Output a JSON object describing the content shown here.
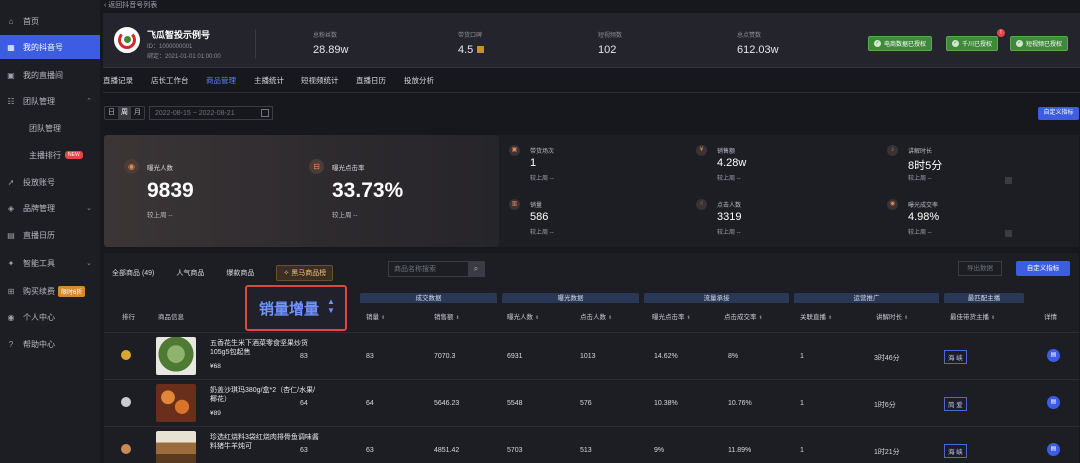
{
  "sidebar": {
    "items": [
      {
        "label": "首页",
        "icon": "home-icon"
      },
      {
        "label": "我的抖音号",
        "icon": "grid-icon",
        "active": true
      },
      {
        "label": "我的直播间",
        "icon": "live-icon"
      },
      {
        "label": "团队管理",
        "icon": "team-icon"
      },
      {
        "label": "团队管理"
      },
      {
        "label": "主播排行",
        "badge": "NEW"
      },
      {
        "label": "投放账号",
        "icon": "rocket-icon"
      },
      {
        "label": "品牌管理",
        "icon": "brand-icon"
      },
      {
        "label": "直播日历",
        "icon": "calendar-icon"
      },
      {
        "label": "智能工具",
        "icon": "tool-icon"
      },
      {
        "label": "购买续费",
        "icon": "cart-icon",
        "tag": "限时6折"
      },
      {
        "label": "个人中心",
        "icon": "user-icon"
      },
      {
        "label": "帮助中心",
        "icon": "help-icon"
      }
    ]
  },
  "header": {
    "back": "返回抖音号列表",
    "name": "飞瓜智投示例号",
    "id": "ID：1000000001",
    "bind": "绑定：2021-01-01 01:00:00",
    "stats": [
      {
        "label": "总粉丝数",
        "value": "28.89w"
      },
      {
        "label": "带货口碑",
        "value": "4.5"
      },
      {
        "label": "短视频数",
        "value": "102"
      },
      {
        "label": "总点赞数",
        "value": "612.03w"
      }
    ],
    "auth_buttons": [
      "电商数据已授权",
      "千川已授权",
      "短视频已授权"
    ]
  },
  "tabs": [
    "直播记录",
    "店长工作台",
    "商品管理",
    "主播统计",
    "短视频统计",
    "直播日历",
    "投放分析"
  ],
  "active_tab": "商品管理",
  "date": {
    "seg": [
      "日",
      "周",
      "月"
    ],
    "range": "2022-08-15 ~ 2022-08-21",
    "custom_btn": "自定义指标"
  },
  "overview": {
    "big": [
      {
        "label": "曝光人数",
        "value": "9839",
        "sub": "较上周 --"
      },
      {
        "label": "曝光点击率",
        "value": "33.73%",
        "sub": "较上周 --"
      }
    ],
    "mini": [
      {
        "label": "带货场次",
        "value": "1",
        "sub": "较上周 --"
      },
      {
        "label": "销售额",
        "value": "4.28w",
        "sub": "较上周 --"
      },
      {
        "label": "讲解时长",
        "value": "8时5分",
        "sub": "较上周 --"
      },
      {
        "label": "销量",
        "value": "586",
        "sub": "较上周 --"
      },
      {
        "label": "点击人数",
        "value": "3319",
        "sub": "较上周 --"
      },
      {
        "label": "曝光成交率",
        "value": "4.98%",
        "sub": "较上周 --"
      }
    ]
  },
  "products": {
    "filter_tabs": [
      "全部商品 (49)",
      "人气商品",
      "爆款商品",
      "黑马商品榜"
    ],
    "search_placeholder": "商品名称搜索",
    "export_btn": "导出数据",
    "custom_btn": "自定义指标",
    "group_headers": [
      "成交数据",
      "曝光数据",
      "流量承接",
      "运营推广",
      "最匹配主播"
    ],
    "columns": [
      "排行",
      "商品信息",
      "销量",
      "销售额",
      "曝光人数",
      "点击人数",
      "曝光点击率",
      "点击成交率",
      "关联直播",
      "讲解时长",
      "最佳带货主播",
      "详情"
    ],
    "highlight": "销量增量",
    "rows": [
      {
        "name": "五香花生米下酒菜零食坚果炒货105g5包起售",
        "price": "¥68",
        "increment": "83",
        "sales": "83",
        "revenue": "7070.3",
        "exposure": "6931",
        "clicks": "1013",
        "ctr": "14.62%",
        "cvr": "8%",
        "live": "1",
        "duration": "3时46分",
        "anchor": "海 峡"
      },
      {
        "name": "奶盖沙琪玛380g/盒*2（杏仁/水果/椰花）",
        "price": "¥89",
        "increment": "64",
        "sales": "64",
        "revenue": "5646.23",
        "exposure": "5548",
        "clicks": "576",
        "ctr": "10.38%",
        "cvr": "10.76%",
        "live": "1",
        "duration": "1时6分",
        "anchor": "简 爱"
      },
      {
        "name": "珍选红烧料3袋红烧肉排骨鱼调味酱料猪牛羊炖可",
        "price": "¥?",
        "increment": "63",
        "sales": "63",
        "revenue": "4851.42",
        "exposure": "5703",
        "clicks": "513",
        "ctr": "9%",
        "cvr": "11.89%",
        "live": "1",
        "duration": "1时21分",
        "anchor": "海 峡"
      }
    ]
  }
}
